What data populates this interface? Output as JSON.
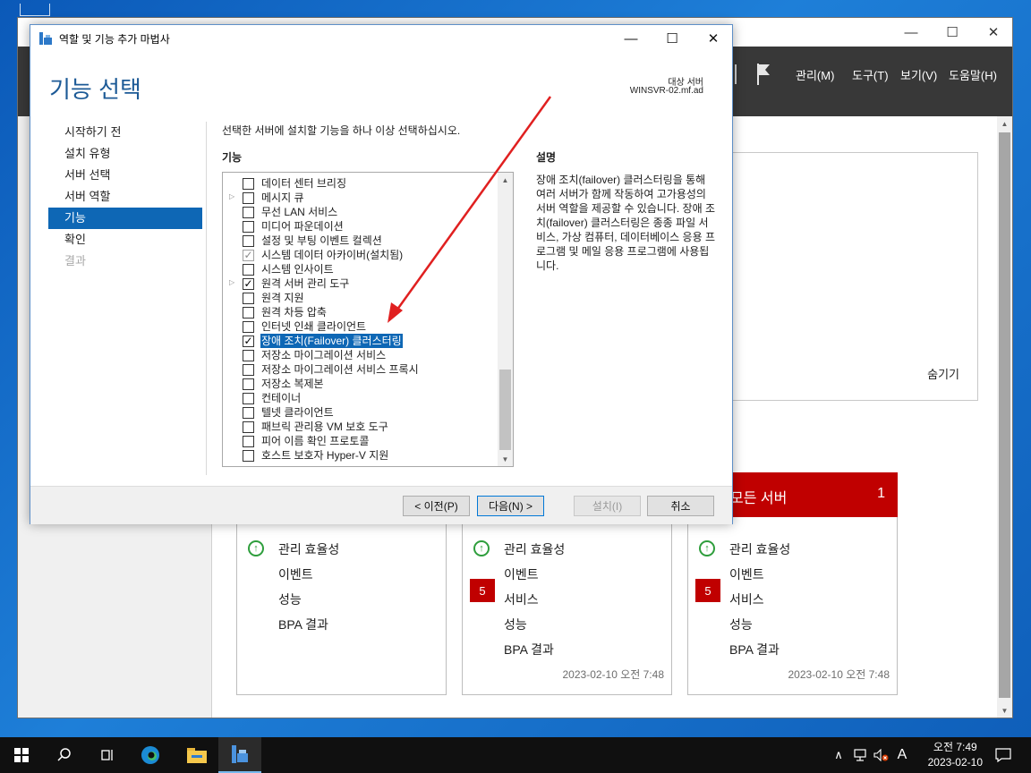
{
  "server_manager": {
    "menu": [
      "관리(M)",
      "도구(T)",
      "보기(V)",
      "도움말(H)"
    ],
    "hide_link": "숨기기",
    "tiles": [
      {
        "title": "",
        "count": "",
        "rows": [
          "관리 효율성",
          "이벤트",
          "성능",
          "BPA 결과"
        ],
        "badge": "",
        "timestamp": ""
      },
      {
        "title": "",
        "count": "",
        "rows": [
          "관리 효율성",
          "이벤트",
          "서비스",
          "성능",
          "BPA 결과"
        ],
        "badge": "5",
        "timestamp": "2023-02-10 오전 7:48"
      },
      {
        "title": "모든 서버",
        "count": "1",
        "rows": [
          "관리 효율성",
          "이벤트",
          "서비스",
          "성능",
          "BPA 결과"
        ],
        "badge": "5",
        "timestamp": "2023-02-10 오전 7:48"
      }
    ]
  },
  "wizard": {
    "window_title": "역할 및 기능 추가 마법사",
    "heading": "기능 선택",
    "target_label": "대상 서버",
    "target_server": "WINSVR-02.mf.ad",
    "nav": [
      "시작하기 전",
      "설치 유형",
      "서버 선택",
      "서버 역할",
      "기능",
      "확인",
      "결과"
    ],
    "nav_active": "기능",
    "instruction": "선택한 서버에 설치할 기능을 하나 이상 선택하십시오.",
    "features_label": "기능",
    "description_label": "설명",
    "description_text": "장애 조치(failover) 클러스터링을 통해 여러 서버가 함께 작동하여 고가용성의 서버 역할을 제공할 수 있습니다. 장애 조치(failover) 클러스터링은 종종 파일 서비스, 가상 컴퓨터, 데이터베이스 응용 프로그램 및 메일 응용 프로그램에 사용됩니다.",
    "features": [
      {
        "name": "데이터 센터 브리징",
        "state": "unchecked",
        "expandable": false
      },
      {
        "name": "메시지 큐",
        "state": "unchecked",
        "expandable": true
      },
      {
        "name": "무선 LAN 서비스",
        "state": "unchecked",
        "expandable": false
      },
      {
        "name": "미디어 파운데이션",
        "state": "unchecked",
        "expandable": false
      },
      {
        "name": "설정 및 부팅 이벤트 컬렉션",
        "state": "unchecked",
        "expandable": false
      },
      {
        "name": "시스템 데이터 아카이버(설치됨)",
        "state": "installed",
        "expandable": false
      },
      {
        "name": "시스템 인사이트",
        "state": "unchecked",
        "expandable": false
      },
      {
        "name": "원격 서버 관리 도구",
        "state": "checked",
        "expandable": true
      },
      {
        "name": "원격 지원",
        "state": "unchecked",
        "expandable": false
      },
      {
        "name": "원격 차등 압축",
        "state": "unchecked",
        "expandable": false
      },
      {
        "name": "인터넷 인쇄 클라이언트",
        "state": "unchecked",
        "expandable": false
      },
      {
        "name": "장애 조치(Failover) 클러스터링",
        "state": "checked",
        "expandable": false,
        "selected": true
      },
      {
        "name": "저장소 마이그레이션 서비스",
        "state": "unchecked",
        "expandable": false
      },
      {
        "name": "저장소 마이그레이션 서비스 프록시",
        "state": "unchecked",
        "expandable": false
      },
      {
        "name": "저장소 복제본",
        "state": "unchecked",
        "expandable": false
      },
      {
        "name": "컨테이너",
        "state": "unchecked",
        "expandable": false
      },
      {
        "name": "텔넷 클라이언트",
        "state": "unchecked",
        "expandable": false
      },
      {
        "name": "패브릭 관리용 VM 보호 도구",
        "state": "unchecked",
        "expandable": false
      },
      {
        "name": "피어 이름 확인 프로토콜",
        "state": "unchecked",
        "expandable": false
      },
      {
        "name": "호스트 보호자 Hyper-V 지원",
        "state": "unchecked",
        "expandable": false
      }
    ],
    "buttons": {
      "previous": "< 이전(P)",
      "next": "다음(N) >",
      "install": "설치(I)",
      "cancel": "취소"
    }
  },
  "taskbar": {
    "input_indicator": "A",
    "time": "오전 7:49",
    "date": "2023-02-10"
  },
  "colors": {
    "accent": "#0e67b5",
    "alert": "#c00000",
    "annotation_arrow": "#e02020"
  }
}
